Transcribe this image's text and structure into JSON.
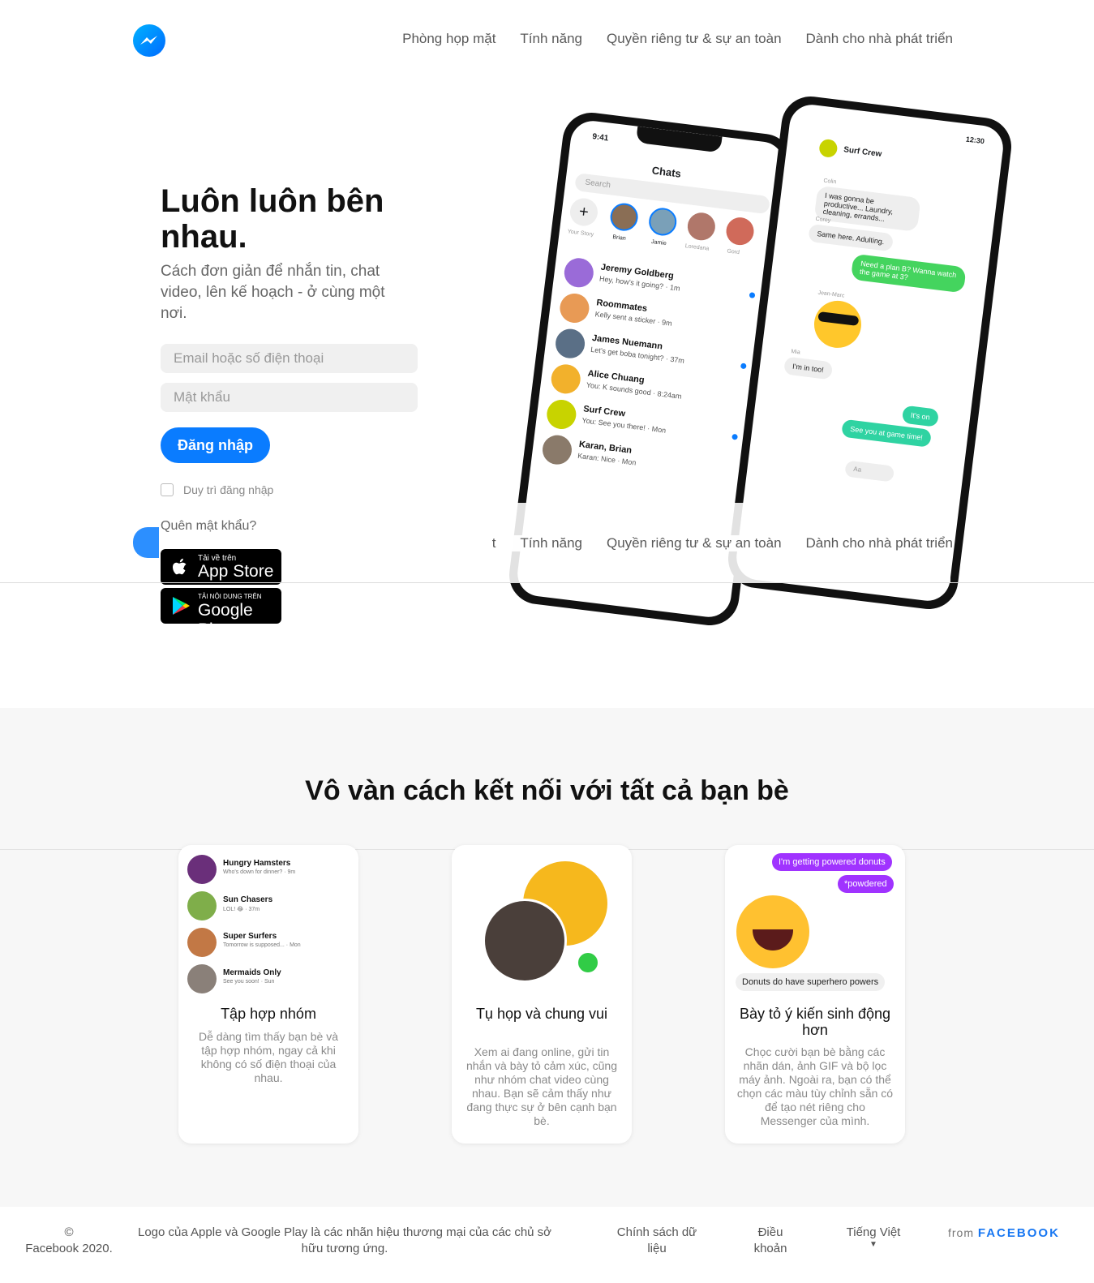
{
  "header": {
    "nav": [
      "Phòng họp mặt",
      "Tính năng",
      "Quyền riêng tư & sự an toàn",
      "Dành cho nhà phát triển"
    ]
  },
  "sticky_nav": [
    "t",
    "Tính năng",
    "Quyền riêng tư & sự an toàn",
    "Dành cho nhà phát triển"
  ],
  "hero": {
    "title": "Luôn luôn bên nhau.",
    "subtitle": "Cách đơn giản để nhắn tin, chat video, lên kế hoạch - ở cùng một nơi.",
    "email_placeholder": "Email hoặc số điện thoại",
    "password_placeholder": "Mật khẩu",
    "login_label": "Đăng nhập",
    "remember_label": "Duy trì đăng nhập",
    "forgot_label": "Quên mật khẩu?",
    "appstore_small": "Tải về trên",
    "appstore_big": "App Store",
    "googleplay_small": "TẢI NỘI DUNG TRÊN",
    "googleplay_big": "Google Play"
  },
  "phone_left": {
    "time": "9:41",
    "title": "Chats",
    "search": "Search",
    "stories": [
      "Your Story",
      "Brian",
      "Jamie",
      "Loredana",
      "Gord"
    ],
    "chats": [
      {
        "name": "Jeremy Goldberg",
        "msg": "Hey, how's it going? · 1m",
        "color": "#9a6bd8"
      },
      {
        "name": "Roommates",
        "msg": "Kelly sent a sticker · 9m",
        "color": "#e89a55"
      },
      {
        "name": "James Nuemann",
        "msg": "Let's get boba tonight? · 37m",
        "color": "#5a6f86"
      },
      {
        "name": "Alice Chuang",
        "msg": "You: K sounds good · 8:24am",
        "color": "#f2b12c"
      },
      {
        "name": "Surf Crew",
        "msg": "You: See you there! · Mon",
        "color": "#c8d300"
      },
      {
        "name": "Karan, Brian",
        "msg": "Karan: Nice · Mon",
        "color": "#8a7a6a"
      }
    ]
  },
  "phone_right": {
    "time": "12:30",
    "title": "Surf Crew",
    "messages": [
      {
        "sender": "Colin",
        "text": "I was gonna be productive... Laundry, cleaning, errands..."
      },
      {
        "sender": "Corey",
        "text": "Same here. Adulting."
      },
      {
        "sender": "",
        "text": "Need a plan B? Wanna watch the game at 3?"
      },
      {
        "sender": "Jean-Marc",
        "text": ""
      },
      {
        "sender": "Mia",
        "text": "I'm in too!"
      },
      {
        "sender": "",
        "text": "It's on"
      },
      {
        "sender": "",
        "text": "See you at game time!"
      }
    ],
    "composer": "Aa"
  },
  "section2": {
    "title": "Vô vàn cách kết nối với tất cả bạn bè",
    "cards": [
      {
        "title": "Tập hợp nhóm",
        "desc": "Dễ dàng tìm thấy bạn bè và tập hợp nhóm, ngay cả khi không có số điện thoại của nhau.",
        "groups": [
          {
            "name": "Hungry Hamsters",
            "msg": "Who's down for dinner? · 9m"
          },
          {
            "name": "Sun Chasers",
            "msg": "LOL! 😂 · 37m"
          },
          {
            "name": "Super Surfers",
            "msg": "Tomorrow is supposed... · Mon"
          },
          {
            "name": "Mermaids Only",
            "msg": "See you soon! · Sun"
          }
        ]
      },
      {
        "title": "Tụ họp và chung vui",
        "desc": "Xem ai đang online, gửi tin nhắn và bày tỏ cảm xúc, cũng như nhóm chat video cùng nhau. Bạn sẽ cảm thấy như đang thực sự ở bên cạnh bạn bè."
      },
      {
        "title": "Bày tỏ ý kiến sinh động hơn",
        "desc": "Chọc cười bạn bè bằng các nhãn dán, ảnh GIF và bộ lọc máy ảnh. Ngoài ra, bạn có thể chọn các màu tùy chỉnh sẵn có để tạo nét riêng cho Messenger của mình.",
        "bubble1": "I'm getting powered donuts",
        "bubble2": "*powdered",
        "caption": "Donuts do have superhero powers"
      }
    ]
  },
  "footer": {
    "copyright_symbol": "©",
    "copyright": "Facebook 2020.",
    "trademark": "Logo của Apple và Google Play là các nhãn hiệu thương mại của các chủ sở hữu tương ứng.",
    "policy": "Chính sách dữ liệu",
    "terms": "Điều khoản",
    "language": "Tiếng Việt",
    "language_arrow": "▼",
    "from": "from",
    "facebook": "FACEBOOK"
  },
  "colors": {
    "primary": "#0a7cff",
    "purple": "#a033ff"
  }
}
